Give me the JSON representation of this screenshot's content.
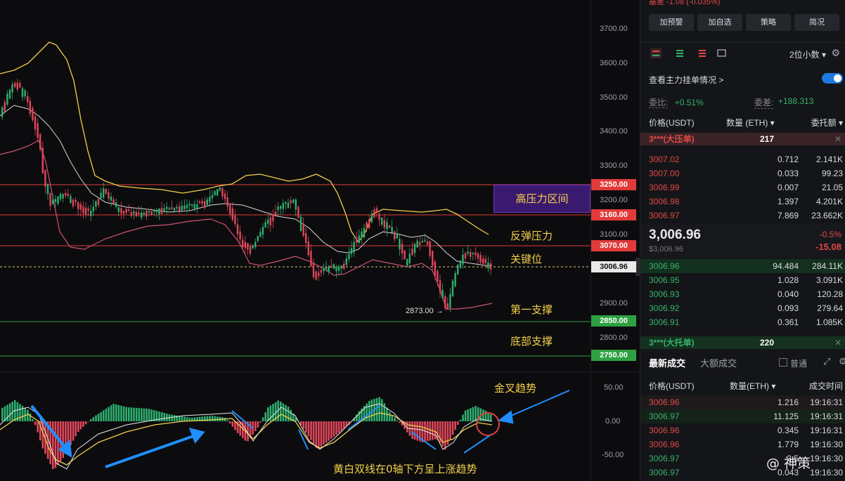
{
  "chart": {
    "y_ticks": [
      "3700.00",
      "3600.00",
      "3500.00",
      "3400.00",
      "3300.00",
      "3200.00",
      "3100.00",
      "2900.00",
      "2800.00"
    ],
    "macd_ticks": [
      "50.00",
      "0.00",
      "-50.00"
    ],
    "price_tags": [
      {
        "label": "3250.00",
        "color": "#e23a3a"
      },
      {
        "label": "3160.00",
        "color": "#e23a3a"
      },
      {
        "label": "3070.00",
        "color": "#e23a3a"
      },
      {
        "label": "3006.96",
        "color": "#e9e9e9"
      },
      {
        "label": "2850.00",
        "color": "#2ea043"
      },
      {
        "label": "2750.00",
        "color": "#2ea043"
      }
    ],
    "zone_label": "高压力区间",
    "annotations": {
      "rebound": "反弹压力",
      "key": "关键位",
      "support1": "第一支撑",
      "support_bottom": "底部支撑",
      "golden_cross": "金叉趋势",
      "macd_note": "黄白双线在0轴下方呈上涨趋势"
    },
    "low_label": "2873.00 →"
  },
  "panel": {
    "top_cut": "基差  -1.08 (-0.035%)",
    "buttons": [
      "加预警",
      "加自选",
      "策略",
      "简况"
    ],
    "decimal": "2位小数 ▾",
    "main_order": "查看主力挂单情况 >",
    "ratio_label": "委比:",
    "ratio_value": "+0.51%",
    "diff_label": "委差:",
    "diff_value": "+188.313",
    "ob_headers": [
      "价格(USDT)",
      "数量 (ETH) ▾",
      "委托额 ▾"
    ],
    "sell_wall": {
      "label": "3***(大压单)",
      "count": "217"
    },
    "asks": [
      {
        "p": "3007.02",
        "q": "0.712",
        "t": "2.141K"
      },
      {
        "p": "3007.00",
        "q": "0.033",
        "t": "99.23"
      },
      {
        "p": "3006.99",
        "q": "0.007",
        "t": "21.05"
      },
      {
        "p": "3006.98",
        "q": "1.397",
        "t": "4.201K"
      },
      {
        "p": "3006.97",
        "q": "7.869",
        "t": "23.662K"
      }
    ],
    "last_price": "3,006.96",
    "last_price_sub": "$3,006.96",
    "pct": "-0.5%",
    "change": "-15.08",
    "bids": [
      {
        "p": "3006.96",
        "q": "94.484",
        "t": "284.11K"
      },
      {
        "p": "3006.95",
        "q": "1.028",
        "t": "3.091K"
      },
      {
        "p": "3006.93",
        "q": "0.040",
        "t": "120.28"
      },
      {
        "p": "3006.92",
        "q": "0.093",
        "t": "279.64"
      },
      {
        "p": "3006.91",
        "q": "0.361",
        "t": "1.085K"
      }
    ],
    "buy_wall": {
      "label": "3***(大托单)",
      "count": "220"
    },
    "tabs": [
      "最新成交",
      "大额成交"
    ],
    "normal": "普通",
    "trade_headers": [
      "价格(USDT)",
      "数量(ETH) ▾",
      "成交时间"
    ],
    "trades": [
      {
        "p": "3006.96",
        "q": "1.216",
        "t": "19:16:31",
        "side": "red"
      },
      {
        "p": "3006.97",
        "q": "11.125",
        "t": "19:16:31",
        "side": "green"
      },
      {
        "p": "3006.96",
        "q": "0.345",
        "t": "19:16:31",
        "side": "red"
      },
      {
        "p": "3006.96",
        "q": "1.779",
        "t": "19:16:30",
        "side": "red"
      },
      {
        "p": "3006.97",
        "q": "3.5",
        "t": "19:16:30",
        "side": "green"
      },
      {
        "p": "3006.97",
        "q": "0.043",
        "t": "19:16:30",
        "side": "green"
      }
    ]
  },
  "watermark": "@ 神策"
}
